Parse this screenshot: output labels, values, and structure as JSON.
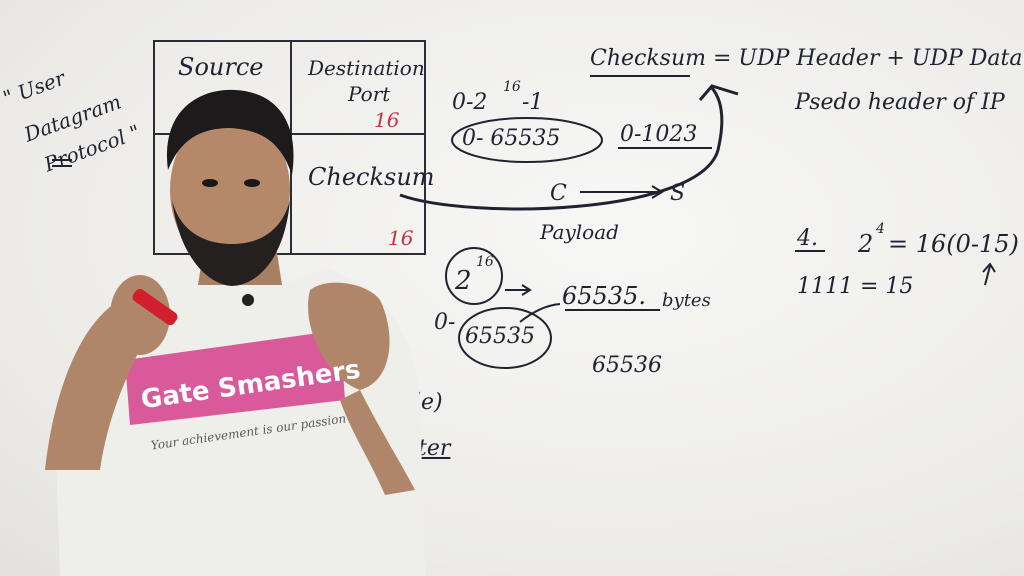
{
  "left_note": [
    "\" User",
    "Datagram",
    "Protocol \""
  ],
  "header_table": {
    "source_label": "Source",
    "destination_label": "Destination",
    "port_label": "Port",
    "destination_bits": "16",
    "checksum_label": "Checksum",
    "checksum_bits": "16"
  },
  "port_range": {
    "power_expr": "0-2",
    "exponent": "16",
    "minus_one": "-1",
    "range_full": "0- 65535",
    "well_known": "0-1023",
    "client": "C",
    "server": "S"
  },
  "payload": {
    "label": "Payload",
    "base": "2",
    "exponent": "16",
    "range": "0-",
    "range_value": "65535",
    "size": "65535.",
    "unit": "bytes",
    "count": "65536"
  },
  "checksum_formula": {
    "line1": "Checksum = UDP Header + UDP Data +",
    "line2": "Psedo header of IP"
  },
  "binary_note": {
    "number": "4.",
    "power": "2",
    "exponent": "4",
    "result": "= 16(0-15)",
    "binary": "1111 = 15"
  },
  "shirt_text": [
    "Gate Smashers",
    "Your achievement is our passion"
  ],
  "partial_text": [
    "le)",
    "ter"
  ]
}
